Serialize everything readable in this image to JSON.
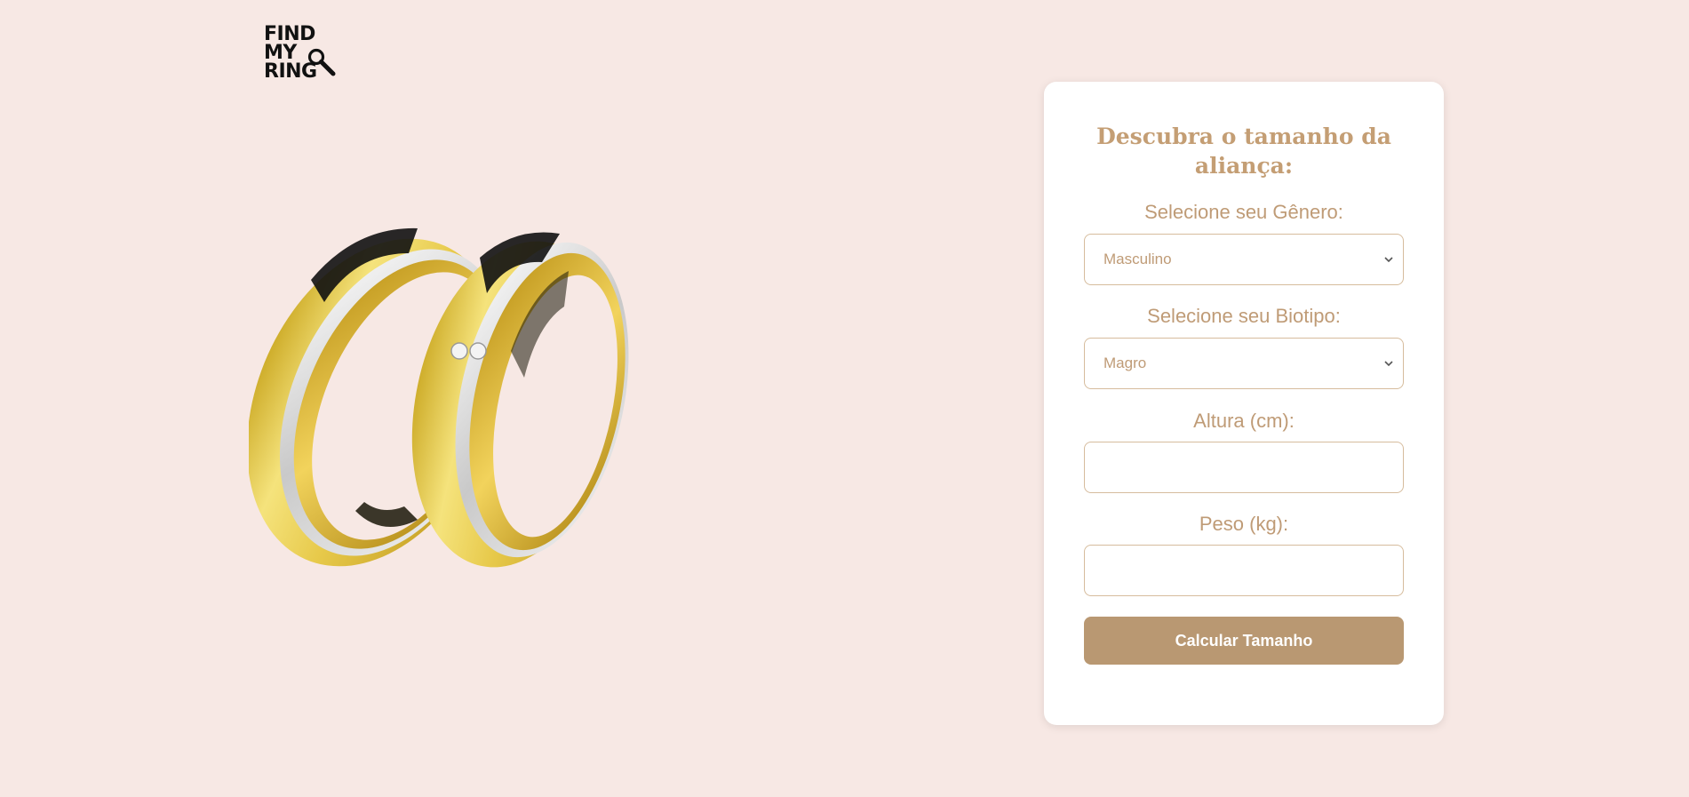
{
  "logo": {
    "line1": "FIND",
    "line2": "MY",
    "line3": "RING",
    "icon": "magnifier-icon"
  },
  "hero": {
    "image": "wedding-rings-image"
  },
  "form": {
    "title": "Descubra o tamanho da aliança:",
    "gender_label": "Selecione seu Gênero:",
    "gender_value": "Masculino",
    "biotype_label": "Selecione seu Biotipo:",
    "biotype_value": "Magro",
    "height_label": "Altura (cm):",
    "weight_label": "Peso (kg):",
    "submit_label": "Calcular Tamanho"
  },
  "colors": {
    "background": "#f7e8e4",
    "card": "#ffffff",
    "accent": "#b99872",
    "label": "#bf9b76",
    "title": "#c49e74"
  }
}
